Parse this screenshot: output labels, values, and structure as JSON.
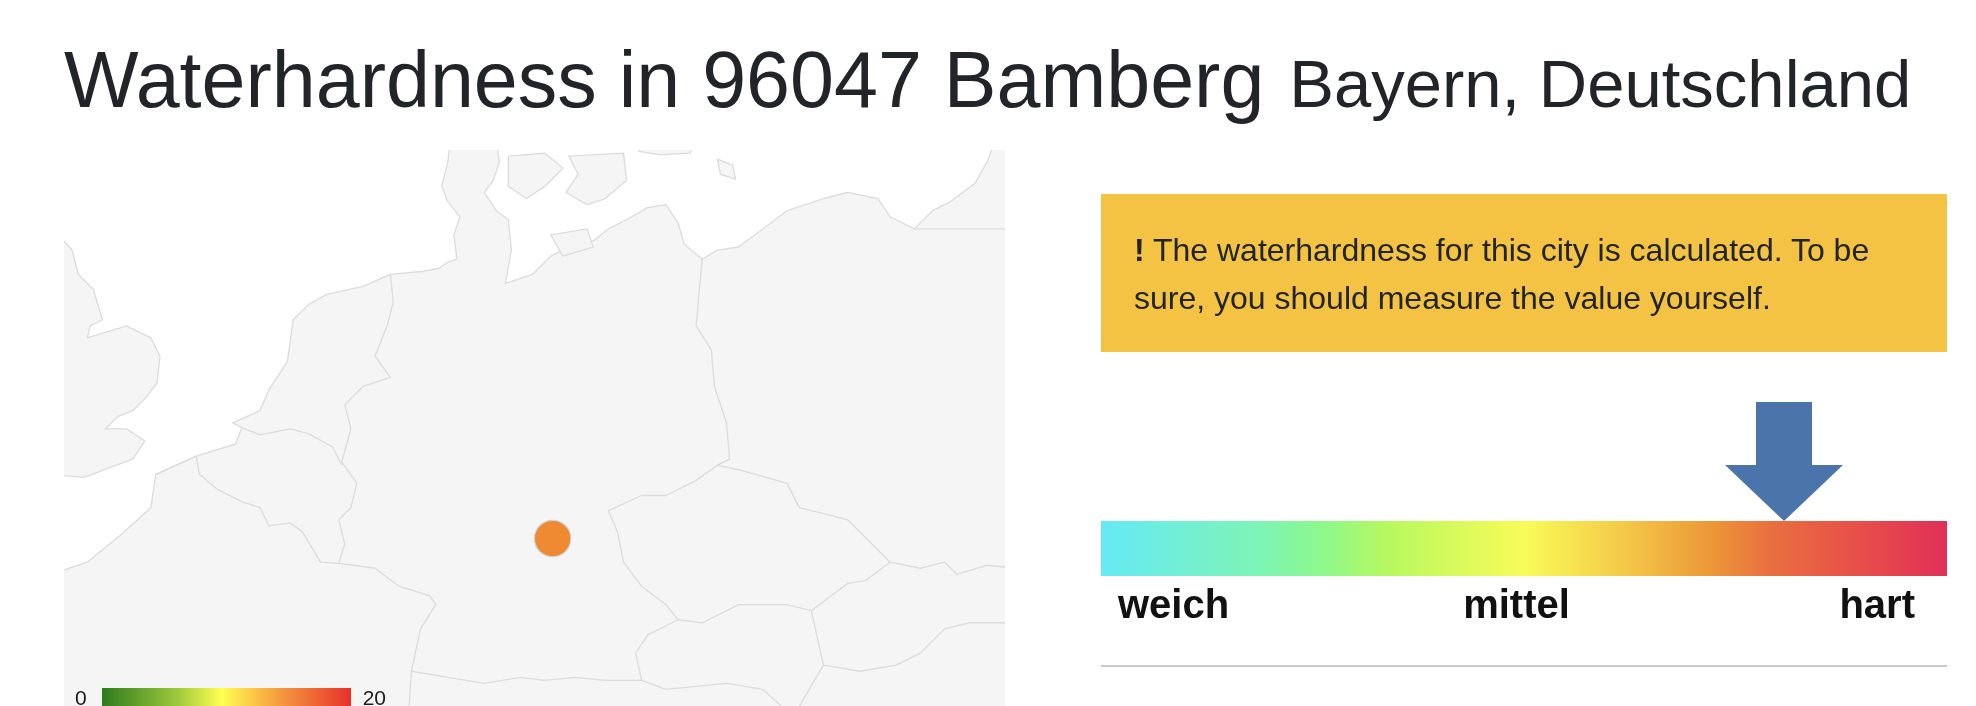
{
  "heading": {
    "title": "Waterhardness in 96047 Bamberg",
    "subtitle": "Bayern, Deutschland"
  },
  "map": {
    "markers": [
      {
        "color": "#ef8a32"
      }
    ],
    "legend": {
      "min": "0",
      "max": "20"
    }
  },
  "notice": {
    "text": "**!** The waterhardness for this city is calculated. To be sure, you should measure the value yourself."
  },
  "hardness_scale": {
    "level": 0.807,
    "labels": [
      "weich",
      "mittel",
      "hart"
    ]
  }
}
